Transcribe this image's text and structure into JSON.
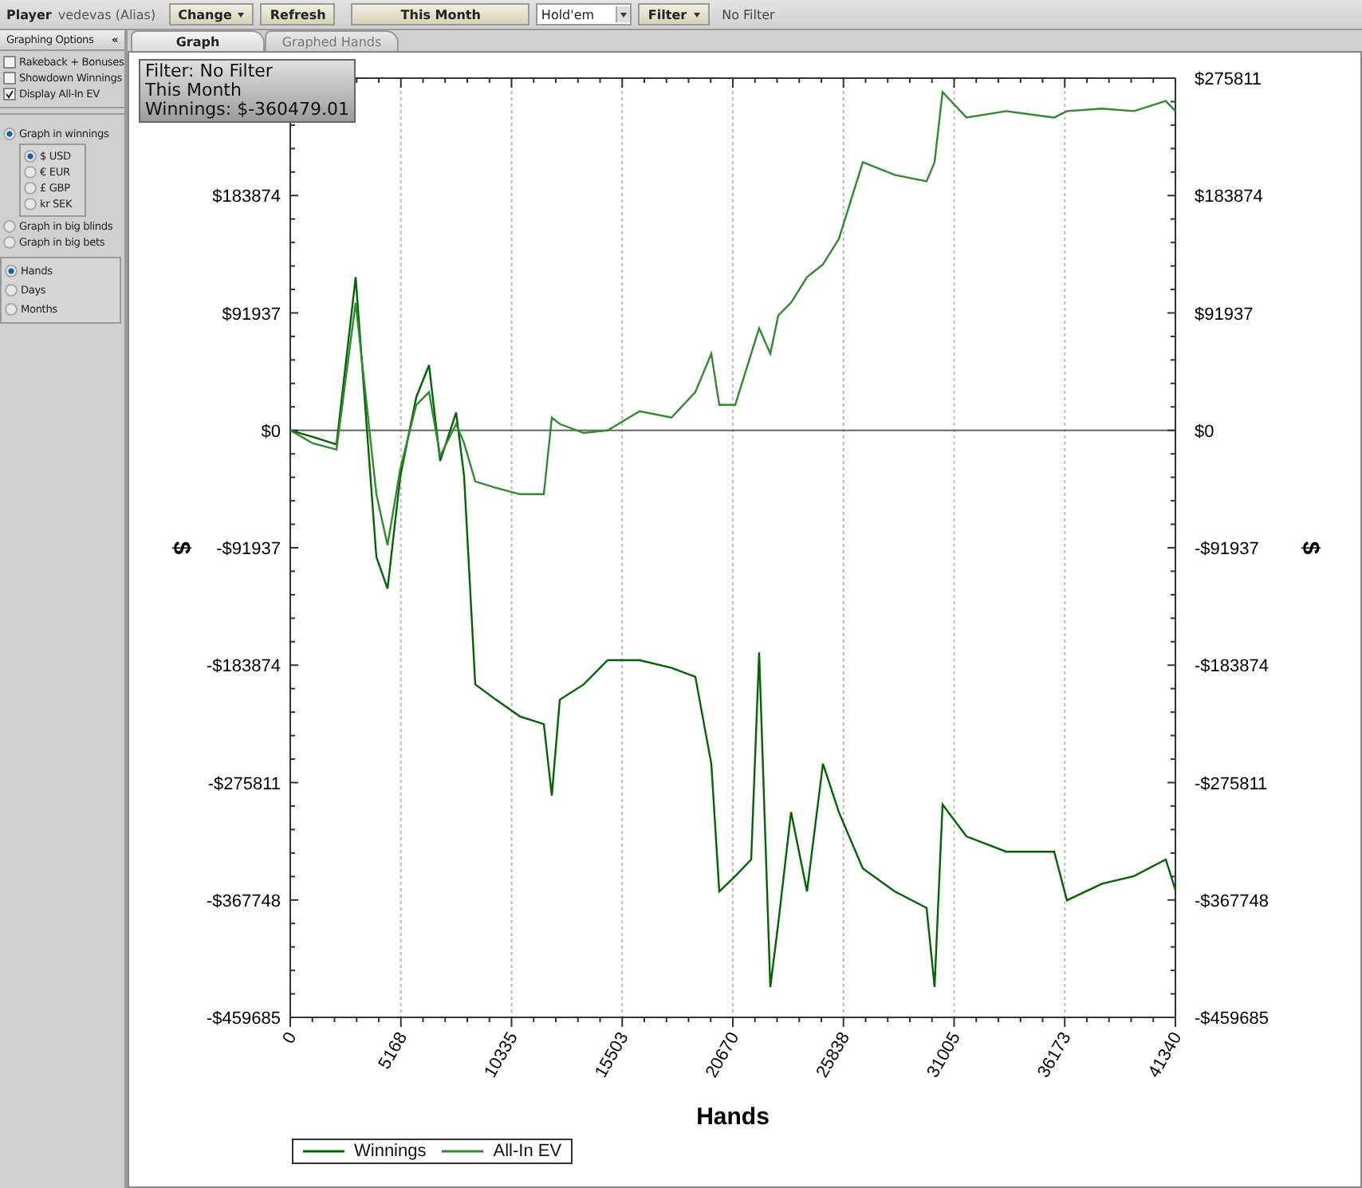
{
  "toolbar": {
    "player_label": "Player",
    "player_name": "vedevas (Alias)",
    "buttons": [
      {
        "label": "Change",
        "kind": "dropdown"
      },
      {
        "label": "Refresh",
        "kind": "plain"
      },
      {
        "label": "This Month",
        "kind": "wide"
      }
    ],
    "game_select": {
      "value": "Hold'em"
    },
    "filter_button": {
      "label": "Filter"
    },
    "filter_status": "No Filter"
  },
  "sidebar": {
    "title": "Graphing Options",
    "collapse": "«",
    "checkboxes": [
      {
        "label": "Rakeback + Bonuses",
        "checked": false
      },
      {
        "label": "Showdown Winnings",
        "checked": false
      },
      {
        "label": "Display All-In EV",
        "checked": true
      }
    ],
    "value_modes": [
      {
        "label": "Graph in winnings",
        "selected": true,
        "currencies": [
          {
            "label": "$ USD",
            "selected": true
          },
          {
            "label": "€ EUR",
            "selected": false
          },
          {
            "label": "£ GBP",
            "selected": false
          },
          {
            "label": "kr SEK",
            "selected": false
          }
        ]
      },
      {
        "label": "Graph in big blinds",
        "selected": false
      },
      {
        "label": "Graph in big bets",
        "selected": false
      }
    ],
    "time_modes": [
      {
        "label": "Hands",
        "selected": true
      },
      {
        "label": "Days",
        "selected": false
      },
      {
        "label": "Months",
        "selected": false
      }
    ]
  },
  "tabs": [
    {
      "label": "Graph",
      "selected": true
    },
    {
      "label": "Graphed Hands",
      "selected": false
    }
  ],
  "info_box": [
    "Filter: No Filter",
    "This Month",
    "Winnings: $-360479.01"
  ],
  "chart_data": {
    "type": "line",
    "grid": true,
    "xlabel": "Hands",
    "ylabel": "$",
    "xlim": [
      0,
      41340
    ],
    "ylim": [
      -459685,
      275811
    ],
    "xticks": [
      0,
      5168,
      10335,
      15503,
      20670,
      25838,
      31005,
      36173,
      41340
    ],
    "yticks": [
      {
        "value": 275811,
        "label": "$275811"
      },
      {
        "value": 183874,
        "label": "$183874"
      },
      {
        "value": 91937,
        "label": "$91937"
      },
      {
        "value": 0,
        "label": "$0"
      },
      {
        "value": -91937,
        "label": "-$91937"
      },
      {
        "value": -183874,
        "label": "-$183874"
      },
      {
        "value": -275811,
        "label": "-$275811"
      },
      {
        "value": -367748,
        "label": "-$367748"
      },
      {
        "value": -459685,
        "label": "-$459685"
      }
    ],
    "x": [
      0,
      1043,
      2160,
      3054,
      4022,
      4544,
      5140,
      5885,
      6481,
      7002,
      7747,
      8119,
      8641,
      9609,
      10727,
      11844,
      12216,
      12589,
      13706,
      14823,
      16313,
      17803,
      18921,
      19666,
      20038,
      20783,
      21528,
      21900,
      22422,
      22794,
      23390,
      24135,
      24880,
      25625,
      26742,
      28232,
      29722,
      30094,
      30467,
      31584,
      33446,
      35681,
      36277,
      37916,
      39406,
      40896,
      41340
    ],
    "series": [
      {
        "name": "Winnings",
        "color": "#006400",
        "values": [
          0,
          -5000,
          -11000,
          120000,
          -99000,
          -124000,
          -36000,
          26000,
          51000,
          -24000,
          14000,
          -36000,
          -199000,
          -211000,
          -224000,
          -230000,
          -286000,
          -211000,
          -199000,
          -180000,
          -180000,
          -186000,
          -193000,
          -261000,
          -361000,
          -349000,
          -336000,
          -174000,
          -436000,
          -386000,
          -299000,
          -361000,
          -261000,
          -299000,
          -343000,
          -361000,
          -374000,
          -436000,
          -293000,
          -318000,
          -330000,
          -330000,
          -368000,
          -355000,
          -349000,
          -336000,
          -360000
        ]
      },
      {
        "name": "All-In EV",
        "color": "#2e8b2e",
        "values": [
          0,
          -10000,
          -15000,
          100000,
          -50000,
          -90000,
          -30000,
          20000,
          30000,
          -20000,
          5000,
          -10000,
          -40000,
          -45000,
          -50000,
          -50000,
          10000,
          5000,
          -2000,
          0,
          15000,
          10000,
          30000,
          60000,
          20000,
          20000,
          60000,
          80000,
          60000,
          90000,
          100000,
          120000,
          130000,
          150000,
          210000,
          200000,
          195000,
          210000,
          265000,
          245000,
          250000,
          245000,
          250000,
          252000,
          250000,
          258000,
          250000
        ]
      }
    ]
  }
}
